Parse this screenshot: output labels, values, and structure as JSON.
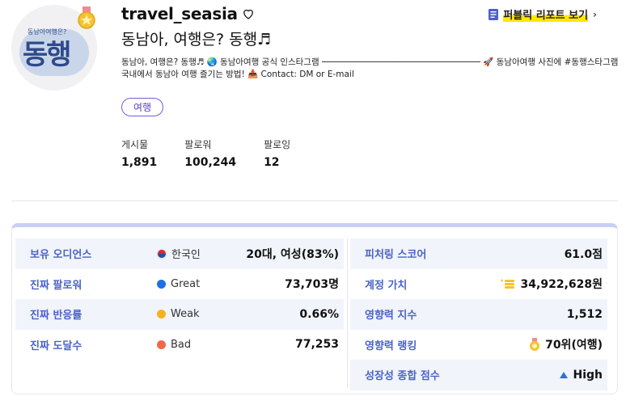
{
  "profile": {
    "avatar_small_text": "동남아여행은?",
    "avatar_big_text": "동행",
    "username": "travel_seasia",
    "display_name": "동남아, 여행은? 동행♬",
    "bio_line1": "동남아, 여행은? 동행♬ 🌏 동남아여행 공식 인스타그램 ─────────────────────────────── 🚀 동남아여행 사진에 #동행스타그램 태그! 💬",
    "bio_line2": "국내에서 동남아 여행 즐기는 방법! 📥 Contact: DM or E-mail",
    "tag": "여행"
  },
  "report": {
    "label": "퍼블릭 리포트 보기",
    "chevron": "›"
  },
  "stats": [
    {
      "label": "게시물",
      "value": "1,891"
    },
    {
      "label": "팔로워",
      "value": "100,244"
    },
    {
      "label": "팔로잉",
      "value": "12"
    }
  ],
  "metrics_left": [
    {
      "key": "보유 오디언스",
      "mid": "한국인",
      "mid_icon": "korea-flag-icon",
      "value": "20대, 여성(83%)"
    },
    {
      "key": "진짜 팔로워",
      "mid": "Great",
      "mid_color": "#1f6fe6",
      "value": "73,703명"
    },
    {
      "key": "진짜 반응률",
      "mid": "Weak",
      "mid_color": "#f5b21e",
      "value": "0.66%"
    },
    {
      "key": "진짜 도달수",
      "mid": "Bad",
      "mid_color": "#f2674a",
      "value": "77,253"
    }
  ],
  "metrics_right": [
    {
      "key": "피처링 스코어",
      "value": "61.0점"
    },
    {
      "key": "계정 가치",
      "value": "34,922,628원",
      "icon": "coins-icon"
    },
    {
      "key": "영향력 지수",
      "value": "1,512"
    },
    {
      "key": "영향력 랭킹",
      "value": "70위(여행)",
      "icon": "medal-icon"
    },
    {
      "key": "성장성 종합 점수",
      "value": "High",
      "icon": "up-triangle-icon"
    }
  ],
  "colors": {
    "accent": "#4b63c8",
    "tag": "#5a3fc0",
    "highlight": "#ffe800",
    "row_alt": "#f1f4fb"
  }
}
